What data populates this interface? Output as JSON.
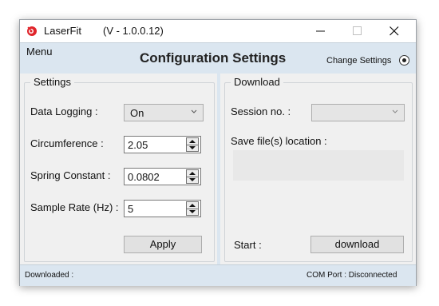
{
  "window": {
    "app_name": "LaserFit",
    "version": "(V - 1.0.0.12)",
    "logo_icon": "red-laser-logo-icon",
    "accent_color": "#dbe6f0"
  },
  "header": {
    "menu_label": "Menu",
    "title": "Configuration Settings",
    "change_settings_label": "Change Settings",
    "change_settings_selected": true
  },
  "settings": {
    "legend": "Settings",
    "data_logging": {
      "label": "Data Logging :",
      "value": "On"
    },
    "circumference": {
      "label": "Circumference :",
      "value": "2.05"
    },
    "spring_constant": {
      "label": "Spring Constant :",
      "value": "0.0802"
    },
    "sample_rate": {
      "label": "Sample Rate (Hz) :",
      "value": "5"
    },
    "apply_label": "Apply"
  },
  "download": {
    "legend": "Download",
    "session_label": "Session no. :",
    "session_value": "",
    "save_location_label": "Save file(s) location :",
    "save_location_value": "",
    "start_label": "Start :",
    "download_label": "download"
  },
  "status": {
    "downloaded_label": "Downloaded :",
    "com_port_label": "COM Port :",
    "com_port_status": "Disconnected"
  }
}
